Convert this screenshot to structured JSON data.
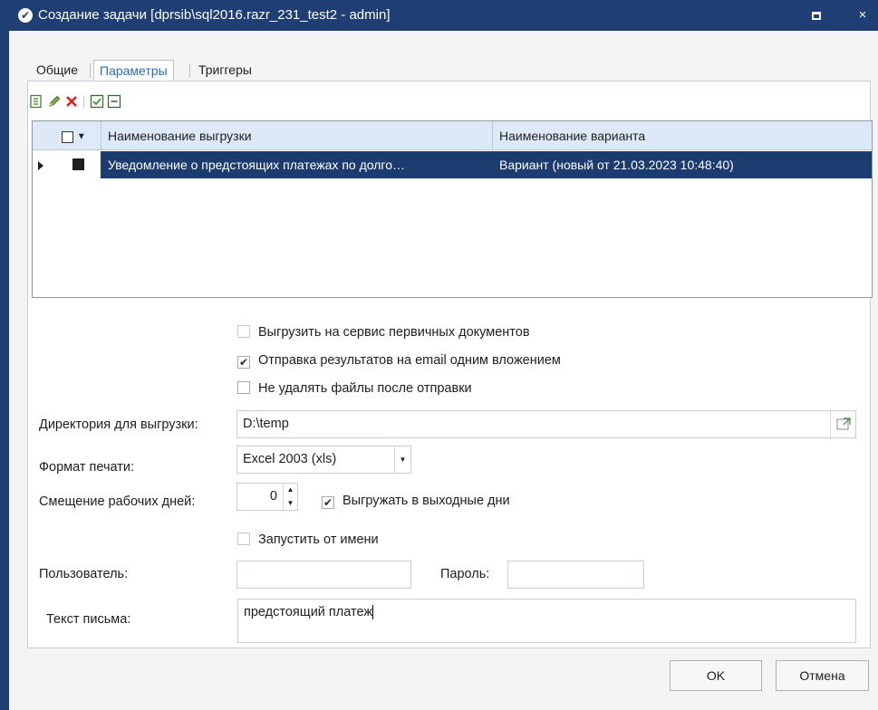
{
  "window": {
    "title": "Создание задачи [dprsib\\sql2016.razr_231_test2 - admin]",
    "icon": "check-circle-icon",
    "maximize_icon": "maximize-icon",
    "close_glyph": "×"
  },
  "tabs": [
    {
      "label": "Общие"
    },
    {
      "label": "Параметры"
    },
    {
      "label": "Триггеры"
    }
  ],
  "toolbar": {
    "icons": [
      "add-row-icon",
      "edit-pencil-icon",
      "delete-icon",
      "check-all-icon",
      "uncheck-all-icon"
    ]
  },
  "grid": {
    "columns": [
      "Наименование выгрузки",
      "Наименование варианта"
    ],
    "rows": [
      {
        "checked": false,
        "name": "Уведомление о предстоящих платежах по долго…",
        "variant": "Вариант (новый от 21.03.2023 10:48:40)"
      }
    ]
  },
  "options": {
    "upload_service": {
      "label": "Выгрузить на сервис первичных документов",
      "checked": false
    },
    "email_single": {
      "label": "Отправка результатов на email одним вложением",
      "checked": true
    },
    "keep_files": {
      "label": "Не удалять файлы после отправки",
      "checked": false
    }
  },
  "form": {
    "dir_label": "Директория для выгрузки:",
    "dir_value": "D:\\temp",
    "format_label": "Формат печати:",
    "format_value": "Excel 2003 (xls)",
    "offset_label": "Смещение рабочих дней:",
    "offset_value": "0",
    "weekend_label": "Выгружать в выходные дни",
    "weekend_checked": true,
    "run_as_label": "Запустить от имени",
    "run_as_checked": false,
    "user_label": "Пользователь:",
    "user_value": "",
    "password_label": "Пароль:",
    "password_value": "",
    "mail_text_label": "Текст письма:",
    "mail_text_value": "предстоящий платеж"
  },
  "buttons": {
    "ok": "OK",
    "cancel": "Отмена"
  },
  "colors": {
    "title_bar": "#1f3e73",
    "selection": "#1c3b6f",
    "active_tab_text": "#2a6bb8",
    "header_bg": "#dde9f6"
  }
}
